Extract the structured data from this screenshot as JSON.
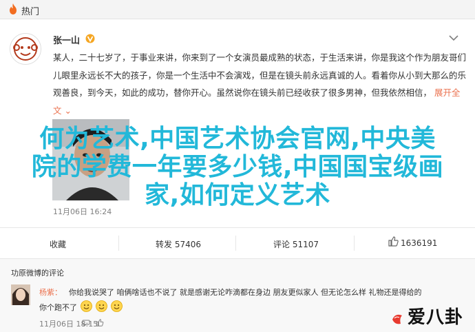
{
  "topbar": {
    "title": "热门",
    "icon": "flame-icon"
  },
  "post": {
    "author": "张一山",
    "verified_badge": "orange-v-icon",
    "text": "某人，二十七岁了，于事业来讲，你来到了一个女演员最成熟的状态，于生活来讲，你是我这个作为朋友哥们儿眼里永远长不大的孩子，你是一个生活中不会演戏，但是在镜头前永远真诚的人。看着你从小到大那么的乐观善良，到今天，如此的成功，替你开心。虽然说你在镜头前已经收获了很多男神，但我依然相信，",
    "fold_label": "展开全文",
    "time": "11月06日 16:24"
  },
  "overlay": {
    "lines": [
      "何为艺术,中国艺术协会官网,中央美",
      "院的学费一年要多少钱,中国国宝级画",
      "家,如何定义艺术"
    ],
    "color": "#22b8d9"
  },
  "actions": {
    "favorite": "收藏",
    "repost": "转发 57406",
    "comment": "评论 51107",
    "like": "1636191"
  },
  "comments": {
    "section_title": "功原微博的评论",
    "items": [
      {
        "name": "杨紫：",
        "text": "你给我说哭了 咱俩啥话也不说了 就是感谢无论咋滴都在身边 朋友更似家人 但无论怎么样 礼物还是得给的",
        "text_cont": "你个跑不了",
        "emoji_count": 3,
        "time": "11月06日 18:15",
        "action_icons": [
          "comment-icon",
          "like-icon"
        ]
      }
    ]
  },
  "watermark": "爱八卦"
}
